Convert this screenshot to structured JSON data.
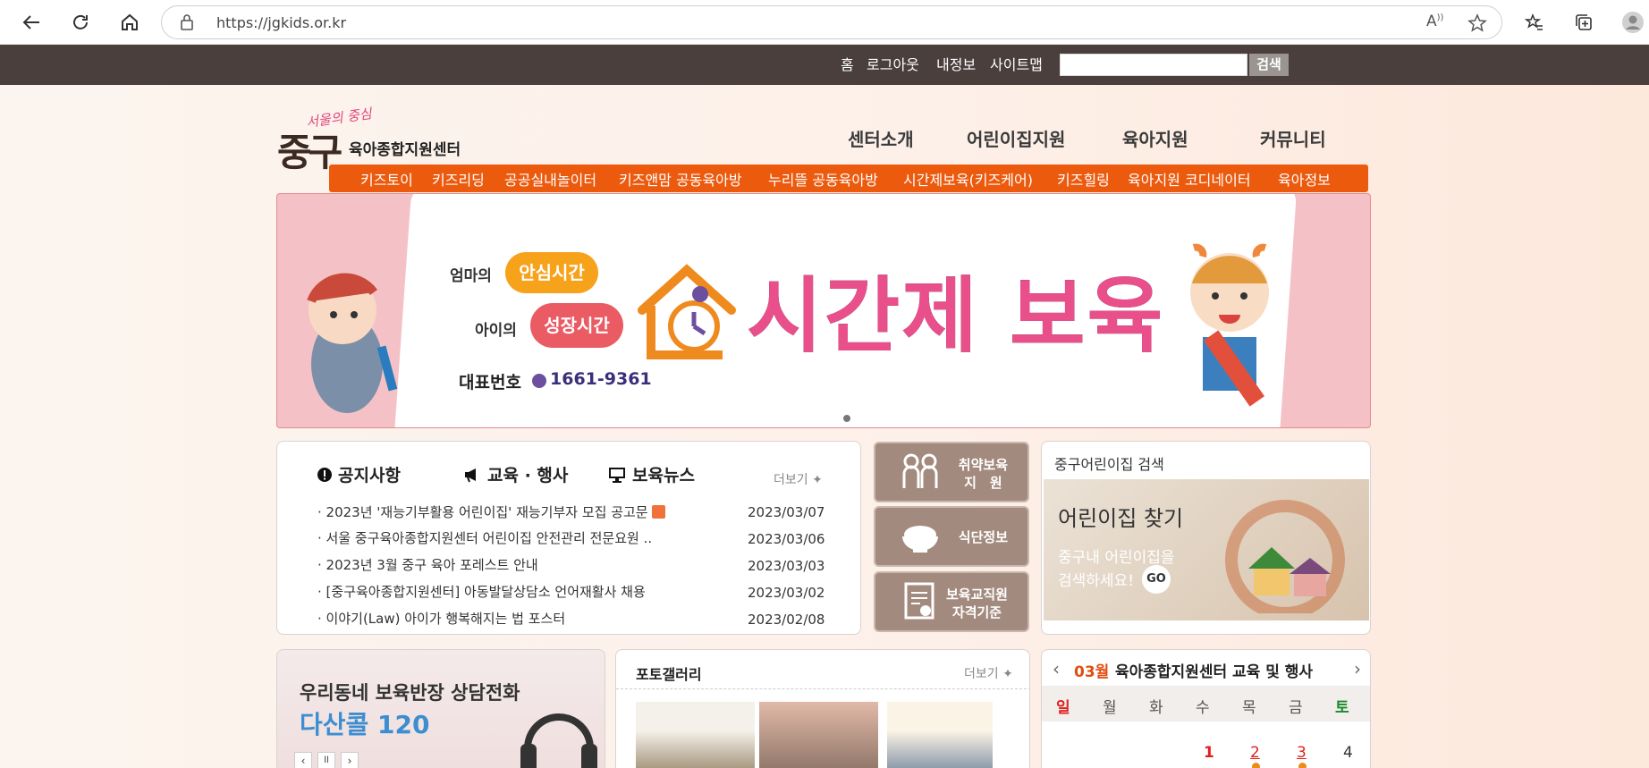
{
  "browser": {
    "url": "https://jgkids.or.kr"
  },
  "util": {
    "home": "홈",
    "logout": "로그아웃",
    "myinfo": "내정보",
    "sitemap": "사이트맵",
    "search_btn": "검색"
  },
  "logo": {
    "small": "서울의 중심",
    "big": "중구",
    "name": "육아종합지원센터"
  },
  "mainnav": [
    "센터소개",
    "어린이집지원",
    "육아지원",
    "커뮤니티"
  ],
  "subnav": [
    "키즈토이",
    "키즈리딩",
    "공공실내놀이터",
    "키즈앤맘 공동육아방",
    "누리뜰 공동육아방",
    "시간제보육(키즈케어)",
    "키즈힐링",
    "육아지원 코디네이터",
    "육아정보"
  ],
  "banner": {
    "mom": "엄마의",
    "safe": "안심시간",
    "child": "아이의",
    "grow": "성장시간",
    "phone_label": "대표번호",
    "phone": "1661-9361",
    "title": "시간제 보육"
  },
  "notice": {
    "tabs": [
      "공지사항",
      "교육 · 행사",
      "보육뉴스"
    ],
    "more": "더보기",
    "rows": [
      {
        "title": "2023년 '재능기부활용 어린이집' 재능기부자 모집 공고문",
        "date": "2023/03/07"
      },
      {
        "title": "서울 중구육아종합지원센터 어린이집 안전관리 전문요원 ..",
        "date": "2023/03/06"
      },
      {
        "title": "2023년 3월 중구 육아 포레스트 안내",
        "date": "2023/03/03"
      },
      {
        "title": "[중구육아종합지원센터] 아동발달상담소 언어재활사 채용",
        "date": "2023/03/02"
      },
      {
        "title": "이야기(Law) 아이가 행복해지는 법 포스터",
        "date": "2023/02/08"
      }
    ]
  },
  "quick": [
    "취약보육\n지　원",
    "식단정보",
    "보육교직원\n자격기준"
  ],
  "finder": {
    "title": "중구어린이집 검색",
    "heading": "어린이집 찾기",
    "desc1": "중구내 어린이집을",
    "desc2": "검색하세요!",
    "go": "GO"
  },
  "promo": {
    "line1": "우리동네 보육반장 상담전화",
    "line2": "다산콜 120"
  },
  "gallery": {
    "title": "포토갤러리",
    "more": "더보기"
  },
  "calendar": {
    "month": "03월",
    "title": "육아종합지원센터 교육 및 행사",
    "days": [
      "일",
      "월",
      "화",
      "수",
      "목",
      "금",
      "토"
    ],
    "dates": [
      "1",
      "2",
      "3",
      "4"
    ]
  },
  "colors": {
    "topbar": "#4a3f3d",
    "orange": "#ec5a0e",
    "brown": "#a38a7e"
  }
}
